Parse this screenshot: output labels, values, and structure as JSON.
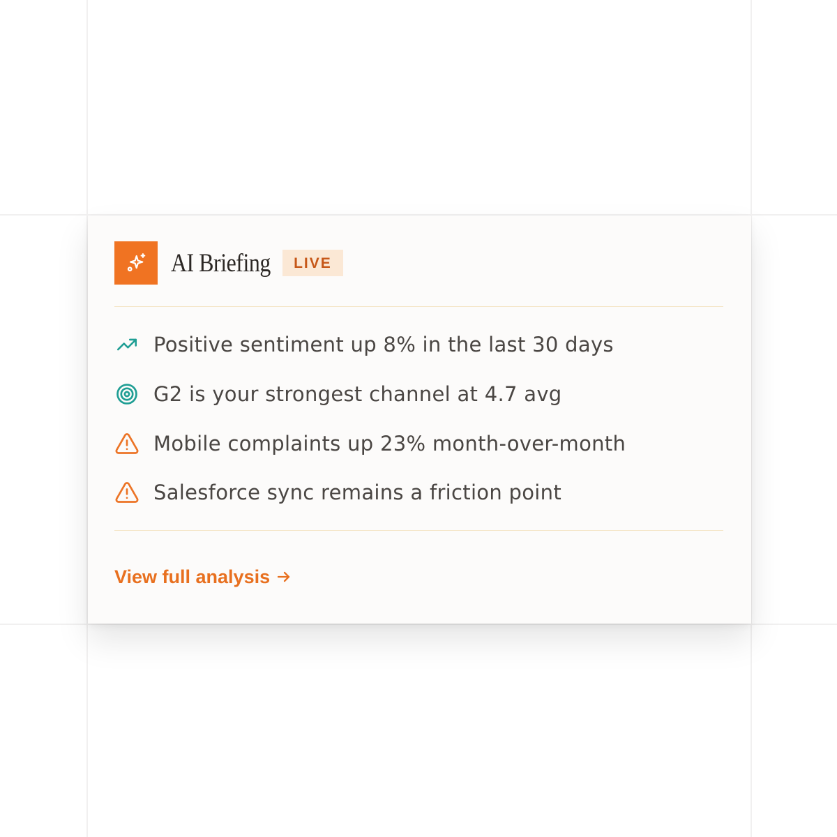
{
  "briefing": {
    "title": "AI Briefing",
    "badge": "LIVE",
    "icons": {
      "logo": "sparkle-icon"
    },
    "insights": [
      {
        "icon": "trending-up-icon",
        "text": "Positive sentiment up 8% in the last 30 days"
      },
      {
        "icon": "target-icon",
        "text": "G2 is your strongest channel at 4.7 avg"
      },
      {
        "icon": "warning-icon",
        "text": "Mobile complaints up 23% month-over-month"
      },
      {
        "icon": "warning-icon",
        "text": "Salesforce sync remains a friction point"
      }
    ],
    "cta_label": "View full analysis"
  },
  "colors": {
    "accent": "#f07322",
    "badge_bg": "#fbe8d5",
    "badge_text": "#c65718",
    "teal": "#1f9e94",
    "warning": "#ec7426",
    "divider": "#f4e5c7",
    "card_bg": "#fcfbfa"
  }
}
